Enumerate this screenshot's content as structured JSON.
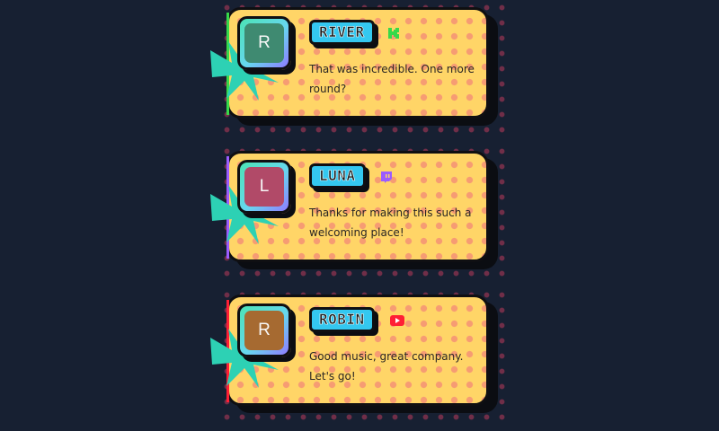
{
  "messages": [
    {
      "initial": "R",
      "username": "RIVER",
      "text": "That was incredible. One more round?",
      "platform_icon": "kick-icon",
      "avatar_color": "#3f8a71",
      "accent_color": "#37d94a"
    },
    {
      "initial": "L",
      "username": "LUNA",
      "text": "Thanks for making this such a welcoming place!",
      "platform_icon": "twitch-icon",
      "avatar_color": "#b14a68",
      "accent_color": "#9b5cff"
    },
    {
      "initial": "R",
      "username": "ROBIN",
      "text": "Good music, great company. Let's go!",
      "platform_icon": "youtube-icon",
      "avatar_color": "#a66a31",
      "accent_color": "#ff1f35"
    }
  ],
  "theme": {
    "background": "#172032",
    "bubble": "#ffd567",
    "name_tag": "#34c8f0",
    "burst": "#2dd1b4"
  }
}
